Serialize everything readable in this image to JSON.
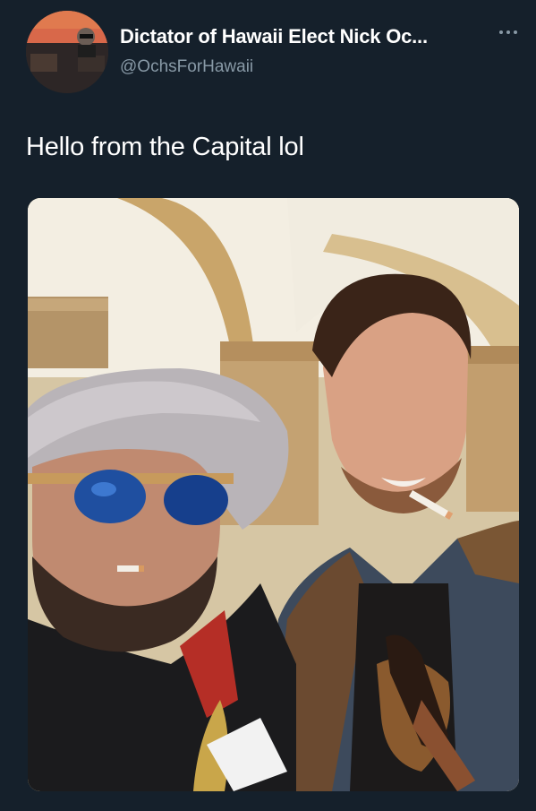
{
  "author": {
    "display_name": "Dictator of Hawaii Elect Nick Oc...",
    "handle": "@OchsForHawaii",
    "avatar_icon": "user-avatar"
  },
  "more_icon": "more-horizontal-icon",
  "tweet": {
    "text": "Hello from the Capital lol"
  },
  "media": {
    "icon": "photo-image"
  },
  "colors": {
    "background": "#15202b",
    "primary_text": "#ffffff",
    "secondary_text": "#8899a6"
  }
}
